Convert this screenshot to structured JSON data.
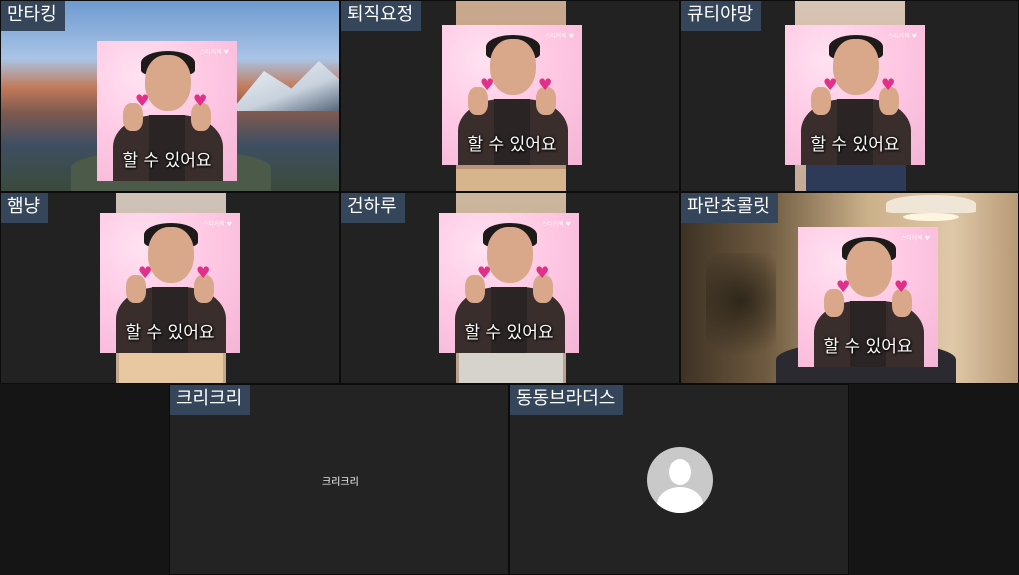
{
  "caption_text": "할 수 있어요",
  "sticker_watermark": "스티커팩 ♥",
  "participants": [
    {
      "name": "만타킹"
    },
    {
      "name": "퇴직요정"
    },
    {
      "name": "큐티야망"
    },
    {
      "name": "햄냥"
    },
    {
      "name": "건하루"
    },
    {
      "name": "파란초콜릿"
    },
    {
      "name": "크리크리",
      "center_label": "크리크리"
    },
    {
      "name": "동동브라더스",
      "avatar": "default-user-avatar-icon"
    }
  ],
  "colors": {
    "name_tag_bg": "#35465a",
    "tile_bg": "#222222",
    "sticker_pink": "#ffc9e4"
  }
}
